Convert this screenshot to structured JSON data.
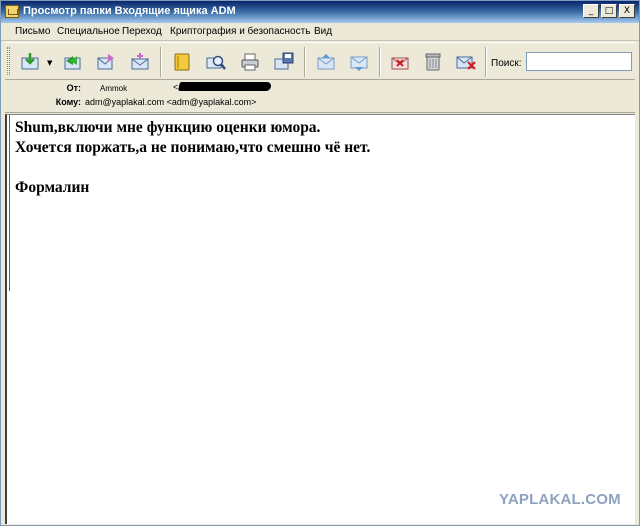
{
  "window": {
    "title": "Просмотр папки Входящие ящика ADM",
    "controls": {
      "minimize": "_",
      "maximize": "□",
      "close": "X"
    }
  },
  "menu": [
    "Письмо",
    "Специальное",
    "Переход",
    "Криптография и безопасность",
    "Вид"
  ],
  "toolbar": {
    "buttons": [
      {
        "icon": "get-mail-icon"
      },
      {
        "icon": "reply-icon"
      },
      {
        "icon": "forward-icon"
      },
      {
        "icon": "new-message-icon"
      },
      {
        "icon": "address-book-icon"
      },
      {
        "icon": "search-icon"
      },
      {
        "icon": "print-icon"
      },
      {
        "icon": "save-icon"
      },
      {
        "icon": "previous-icon"
      },
      {
        "icon": "next-icon"
      },
      {
        "icon": "mark-junk-icon"
      },
      {
        "icon": "trash-icon"
      },
      {
        "icon": "delete-icon"
      }
    ],
    "dropdown_glyph": "▼",
    "search_label": "Поиск:",
    "search_value": ""
  },
  "headers": {
    "from_label": "От:",
    "from_name": "Ammok",
    "from_email_prefix": "<",
    "to_label": "Кому:",
    "to_value": "adm@yaplakal.com <adm@yaplakal.com>"
  },
  "message": {
    "lines": [
      "Shum,включи мне функцию оценки юмора.",
      "Хочется поржать,а не понимаю,что смешно чё нет.",
      "",
      "Формалин"
    ]
  },
  "watermark": "YAPLAKAL.COM",
  "colors": {
    "titlebar_start": "#0a246a",
    "titlebar_end": "#a6caf0",
    "chrome": "#ece9d8",
    "watermark": "#8ea2c0"
  }
}
